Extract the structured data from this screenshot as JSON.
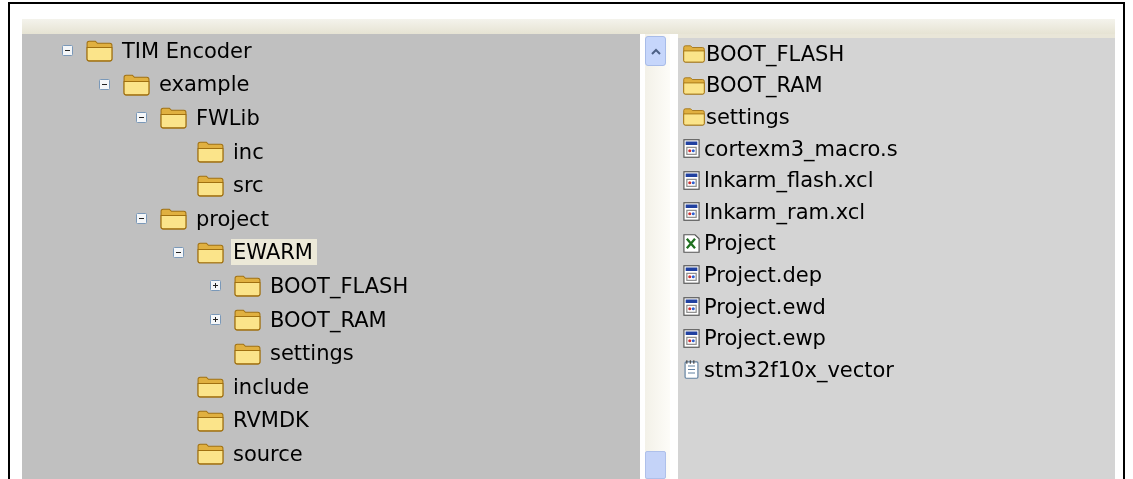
{
  "tree": [
    {
      "label": "TIM Encoder",
      "expanded": true,
      "selected": false,
      "children": [
        {
          "label": "example",
          "expanded": true,
          "selected": false,
          "children": [
            {
              "label": "FWLib",
              "expanded": true,
              "selected": false,
              "children": [
                {
                  "label": "inc",
                  "selected": false
                },
                {
                  "label": "src",
                  "selected": false
                }
              ]
            },
            {
              "label": "project",
              "expanded": true,
              "selected": false,
              "children": [
                {
                  "label": "EWARM",
                  "expanded": true,
                  "selected": true,
                  "children": [
                    {
                      "label": "BOOT_FLASH",
                      "expanded": false,
                      "selected": false
                    },
                    {
                      "label": "BOOT_RAM",
                      "expanded": false,
                      "selected": false
                    },
                    {
                      "label": "settings",
                      "selected": false
                    }
                  ]
                },
                {
                  "label": "include",
                  "selected": false
                },
                {
                  "label": "RVMDK",
                  "selected": false
                },
                {
                  "label": "source",
                  "selected": false
                }
              ]
            }
          ]
        }
      ]
    }
  ],
  "files": [
    {
      "name": "BOOT_FLASH",
      "kind": "folder"
    },
    {
      "name": "BOOT_RAM",
      "kind": "folder"
    },
    {
      "name": "settings",
      "kind": "folder"
    },
    {
      "name": "cortexm3_macro.s",
      "kind": "document"
    },
    {
      "name": "lnkarm_flash.xcl",
      "kind": "document"
    },
    {
      "name": "lnkarm_ram.xcl",
      "kind": "document"
    },
    {
      "name": "Project",
      "kind": "workspace"
    },
    {
      "name": "Project.dep",
      "kind": "document"
    },
    {
      "name": "Project.ewd",
      "kind": "document"
    },
    {
      "name": "Project.ewp",
      "kind": "document"
    },
    {
      "name": "stm32f10x_vector",
      "kind": "text"
    }
  ]
}
